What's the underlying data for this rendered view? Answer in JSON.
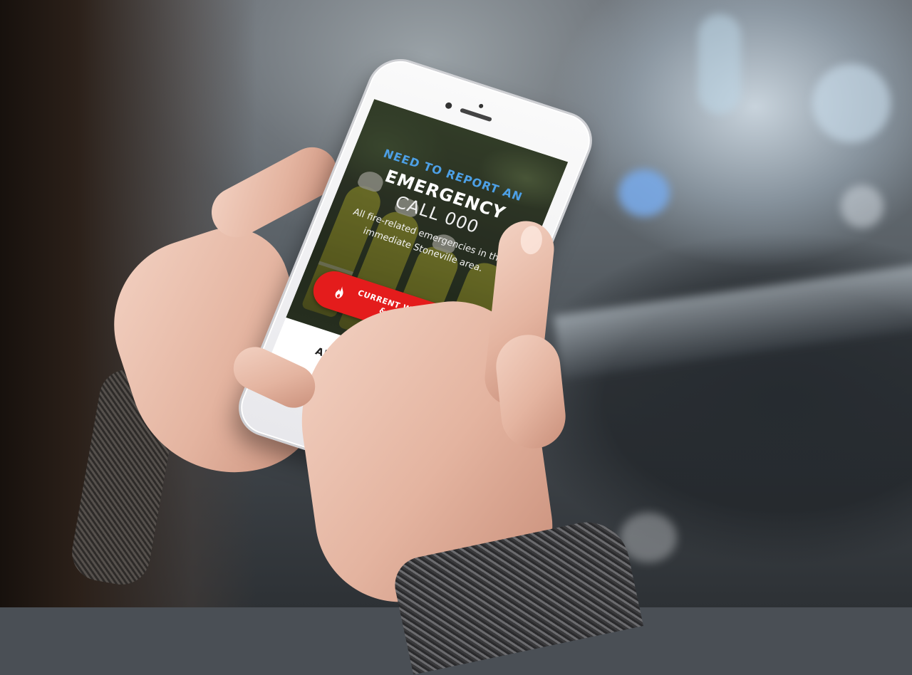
{
  "hero": {
    "kicker": "NEED TO REPORT AN",
    "headline": "EMERGENCY",
    "call_number": "CALL 000",
    "description": "All fire-related emergencies in the immediate Stoneville area."
  },
  "alert_button": {
    "label": "CURRENT WARNINGS & ALERTS",
    "icon": "flame-icon"
  },
  "prepared": {
    "title": "ARE YOU PREPARED?"
  },
  "scroll_top": {
    "icon": "chevron-up-icon"
  },
  "colors": {
    "accent_blue": "#4da0e6",
    "alert_red": "#e41c1c",
    "heading_dark": "#222222"
  }
}
